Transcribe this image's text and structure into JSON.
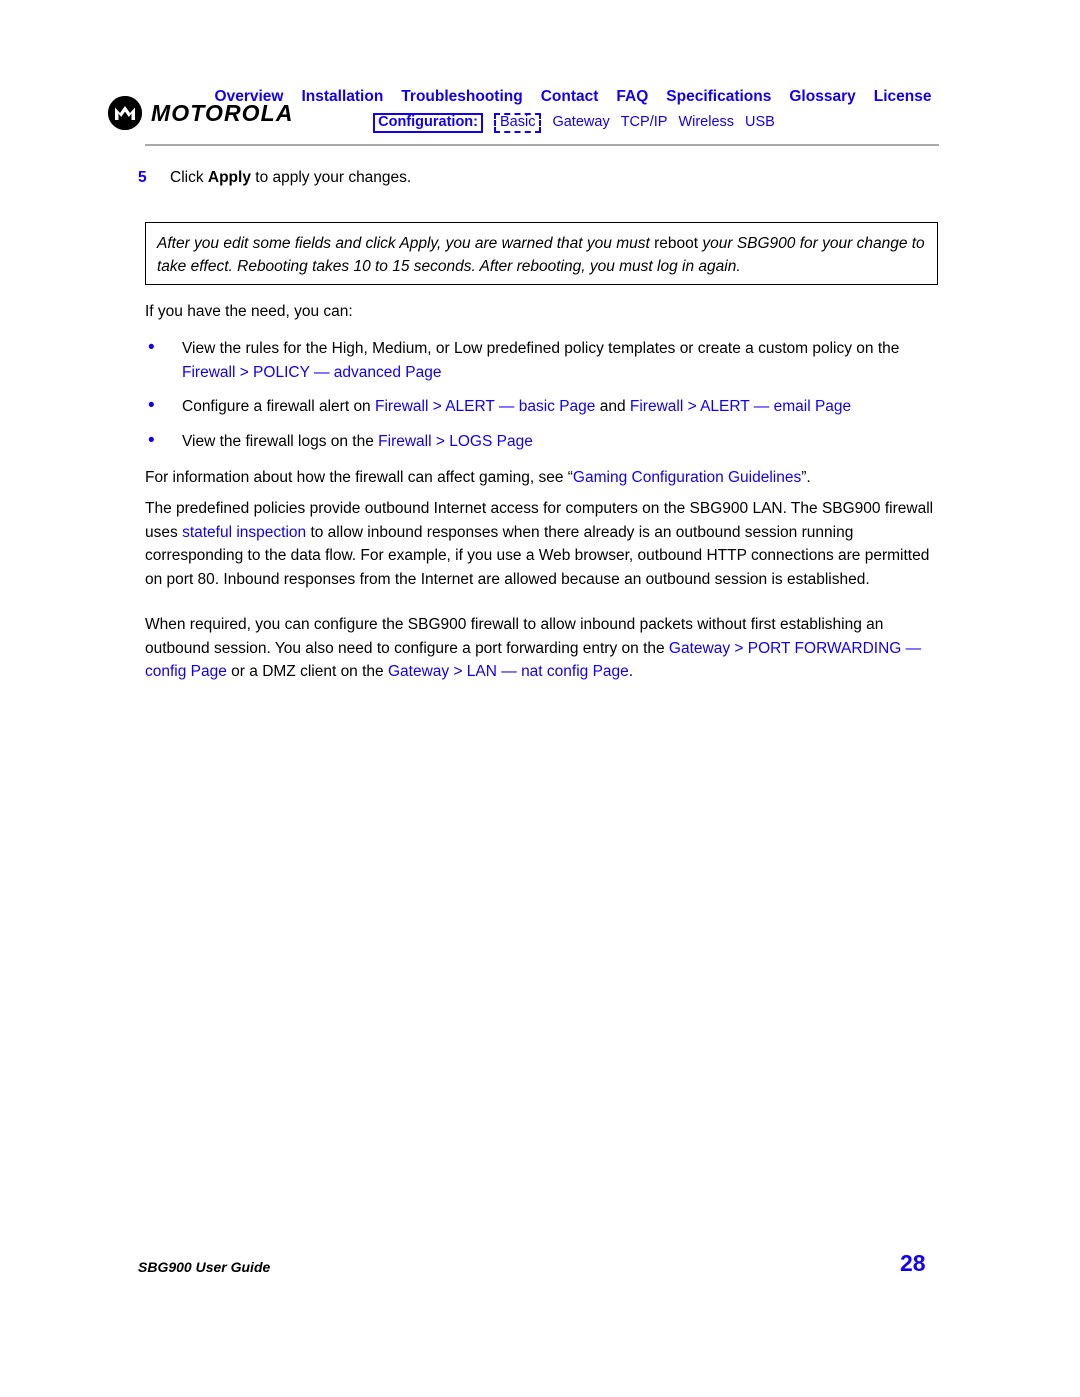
{
  "header": {
    "logo": {
      "mark_name": "motorola-batwing-logo",
      "wordmark": "MOTOROLA"
    },
    "nav_primary": [
      "Overview",
      "Installation",
      "Troubleshooting",
      "Contact",
      "FAQ",
      "Specifications",
      "Glossary",
      "License"
    ],
    "nav_secondary": {
      "label": "Configuration:",
      "selected": "Basic",
      "items": [
        "Gateway",
        "TCP/IP",
        "Wireless",
        "USB"
      ]
    }
  },
  "colors": {
    "link_blue": "#1200f0",
    "rule_gray": "#a9a9a9",
    "text_black": "#000000"
  },
  "body": {
    "step": {
      "number": "5",
      "text_before": "Click ",
      "bold_word": "Apply",
      "text_after": " to apply your changes."
    },
    "note": {
      "line1_a": "After you edit some fields and click Apply, you are warned that you must ",
      "line1_upright": "reboot",
      "line1_b": " your SBG900 for your change",
      "line2": "to take effect. Rebooting takes 10 to 15 seconds. After rebooting, you must log in again."
    },
    "intro": "If you have the need, you can:",
    "bullets": [
      {
        "text_a": "View the rules for the High, Medium, or Low predefined policy templates or create a custom policy on the ",
        "link_1": "Firewall > POLICY — advanced Page",
        "text_b": "",
        "link_2": "",
        "text_c": ""
      },
      {
        "text_a": "Configure a firewall alert on ",
        "link_1": "Firewall > ALERT — basic Page",
        "text_b": " and ",
        "link_2": "Firewall > ALERT — email Page",
        "text_c": ""
      },
      {
        "text_a": "View the firewall logs on the ",
        "link_1": "Firewall > LOGS Page",
        "text_b": "",
        "link_2": "",
        "text_c": ""
      }
    ],
    "info_paragraph": {
      "text_a": "For information about how the firewall can affect gaming, see “",
      "link": "Gaming Configuration Guidelines",
      "text_b": "”."
    },
    "policies_paragraph": {
      "text_a": "The predefined policies provide outbound Internet access for computers on the SBG900 LAN. The SBG900 firewall uses ",
      "link": "stateful inspection",
      "text_b": " to allow inbound responses when there already is an outbound session running corresponding to the data flow. For example, if you use a Web browser, outbound HTTP connections are permitted on port 80. Inbound responses from the Internet are allowed because an outbound session is established."
    },
    "when_paragraph": {
      "text_a": "When required, you can configure the SBG900 firewall to allow inbound packets without first establishing an outbound session. You also need to configure a port forwarding entry on the ",
      "link_1": "Gateway > PORT FORWARDING — config Page",
      "text_b": " or a DMZ client on the ",
      "link_2": "Gateway > LAN — nat config Page",
      "text_c": "."
    }
  },
  "footer": {
    "doc_title": "SBG900 User Guide",
    "page_number": "28"
  }
}
